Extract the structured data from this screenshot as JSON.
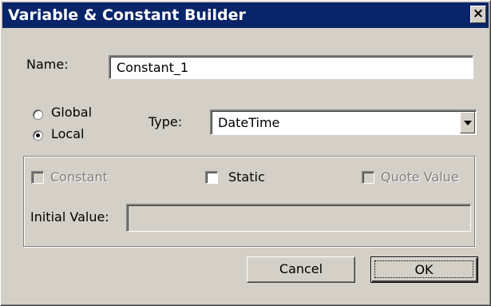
{
  "window": {
    "title": "Variable & Constant Builder",
    "close_glyph": "×"
  },
  "name_field": {
    "label": "Name:",
    "value": "Constant_1"
  },
  "scope": {
    "options": [
      {
        "label": "Global",
        "selected": false
      },
      {
        "label": "Local",
        "selected": true
      }
    ]
  },
  "type_field": {
    "label": "Type:",
    "value": "DateTime"
  },
  "options": {
    "constant": {
      "label": "Constant",
      "checked": false,
      "enabled": false
    },
    "static": {
      "label": "Static",
      "checked": false,
      "enabled": true
    },
    "quote_value": {
      "label": "Quote Value",
      "checked": false,
      "enabled": false
    }
  },
  "initial_value": {
    "label": "Initial Value:",
    "value": ""
  },
  "buttons": {
    "cancel": "Cancel",
    "ok": "OK"
  },
  "colors": {
    "dialog_face": "#d4d0c8",
    "title_bar": "#0a246a",
    "disabled_text": "#808080"
  }
}
